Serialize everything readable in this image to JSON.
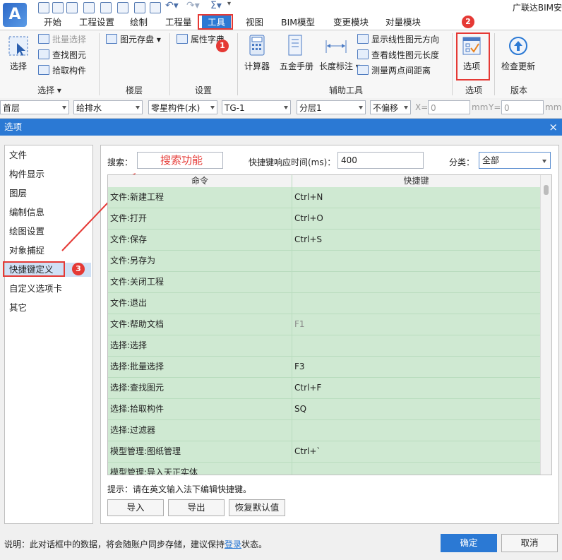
{
  "app": {
    "logo": "A",
    "title_partial": "广联达BIM安"
  },
  "menu_tabs": [
    "开始",
    "工程设置",
    "绘制",
    "工程量",
    "工具",
    "视图",
    "BIM模型",
    "变更模块",
    "对量模块"
  ],
  "ribbon": {
    "groups": [
      {
        "label": "选择",
        "big": "选择",
        "small": [
          "批量选择",
          "查找图元",
          "拾取构件"
        ]
      },
      {
        "label": "楼层",
        "small": [
          "图元存盘"
        ]
      },
      {
        "label": "设置",
        "small": [
          "属性字典"
        ]
      },
      {
        "label": "辅助工具",
        "big": [
          "计算器",
          "五金手册",
          "长度标注"
        ],
        "small": [
          "显示线性图元方向",
          "查看线性图元长度",
          "测量两点间距离"
        ]
      },
      {
        "label": "选项",
        "big": "选项"
      },
      {
        "label": "版本",
        "big": "检查更新"
      }
    ]
  },
  "toolbar": {
    "floor": "首层",
    "discipline": "给排水",
    "component_type": "零星构件(水)",
    "component": "TG-1",
    "layer": "分层1",
    "offset": "不偏移",
    "x_label": "X=",
    "x_value": "0",
    "unit_mm": "mm",
    "y_label": "Y=",
    "y_value": "0"
  },
  "dialog": {
    "title": "选项",
    "close": "×",
    "nav": [
      "文件",
      "构件显示",
      "图层",
      "编制信息",
      "绘图设置",
      "对象捕捉",
      "快捷键定义",
      "自定义选项卡",
      "其它"
    ],
    "search_label": "搜索：",
    "search_annotation": "搜索功能",
    "response_label": "快捷键响应时间(ms)：",
    "response_value": "400",
    "category_label": "分类：",
    "category_value": "全部",
    "table": {
      "headers": [
        "命令",
        "快捷键"
      ],
      "rows": [
        {
          "cmd": "文件:新建工程",
          "key": "Ctrl+N"
        },
        {
          "cmd": "文件:打开",
          "key": "Ctrl+O"
        },
        {
          "cmd": "文件:保存",
          "key": "Ctrl+S"
        },
        {
          "cmd": "文件:另存为",
          "key": ""
        },
        {
          "cmd": "文件:关闭工程",
          "key": ""
        },
        {
          "cmd": "文件:退出",
          "key": ""
        },
        {
          "cmd": "文件:帮助文档",
          "key": "F1"
        },
        {
          "cmd": "选择:选择",
          "key": ""
        },
        {
          "cmd": "选择:批量选择",
          "key": "F3"
        },
        {
          "cmd": "选择:查找图元",
          "key": "Ctrl+F"
        },
        {
          "cmd": "选择:拾取构件",
          "key": "SQ"
        },
        {
          "cmd": "选择:过滤器",
          "key": ""
        },
        {
          "cmd": "模型管理:图纸管理",
          "key": "Ctrl+`"
        },
        {
          "cmd": "模型管理:导入天正实体",
          "key": ""
        }
      ]
    },
    "hint": "提示：请在英文输入法下编辑快捷键。",
    "buttons": {
      "import": "导入",
      "export": "导出",
      "restore": "恢复默认值"
    },
    "footer_note_prefix": "说明：此对话框中的数据，将会随账户同步存储，建议保持",
    "footer_note_link": "登录",
    "footer_note_suffix": "状态。",
    "ok": "确定",
    "cancel": "取消"
  },
  "annotations": {
    "badge1": "1",
    "badge2": "2",
    "badge3": "3",
    "color": "#e53935"
  }
}
